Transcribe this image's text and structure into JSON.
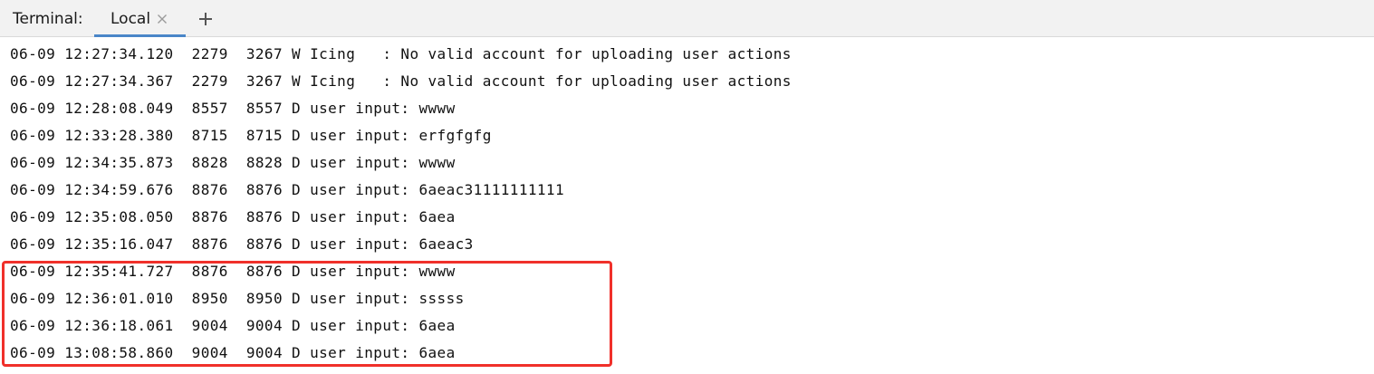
{
  "toolwindow": {
    "label": "Terminal:",
    "tabs": [
      {
        "label": "Local",
        "active": true,
        "close_icon": "close-icon"
      }
    ],
    "add_icon": "plus-icon",
    "accent_color": "#4a86c8"
  },
  "console": {
    "lines": [
      "06-09 12:27:34.120  2279  3267 W Icing   : No valid account for uploading user actions",
      "06-09 12:27:34.367  2279  3267 W Icing   : No valid account for uploading user actions",
      "06-09 12:28:08.049  8557  8557 D user input: wwww",
      "06-09 12:33:28.380  8715  8715 D user input: erfgfgfg",
      "06-09 12:34:35.873  8828  8828 D user input: wwww",
      "06-09 12:34:59.676  8876  8876 D user input: 6aeac31111111111",
      "06-09 12:35:08.050  8876  8876 D user input: 6aea",
      "06-09 12:35:16.047  8876  8876 D user input: 6aeac3",
      "06-09 12:35:41.727  8876  8876 D user input: wwww",
      "06-09 12:36:01.010  8950  8950 D user input: sssss",
      "06-09 12:36:18.061  9004  9004 D user input: 6aea",
      "06-09 13:08:58.860  9004  9004 D user input: 6aea"
    ],
    "highlight_color": "#f0302a"
  }
}
